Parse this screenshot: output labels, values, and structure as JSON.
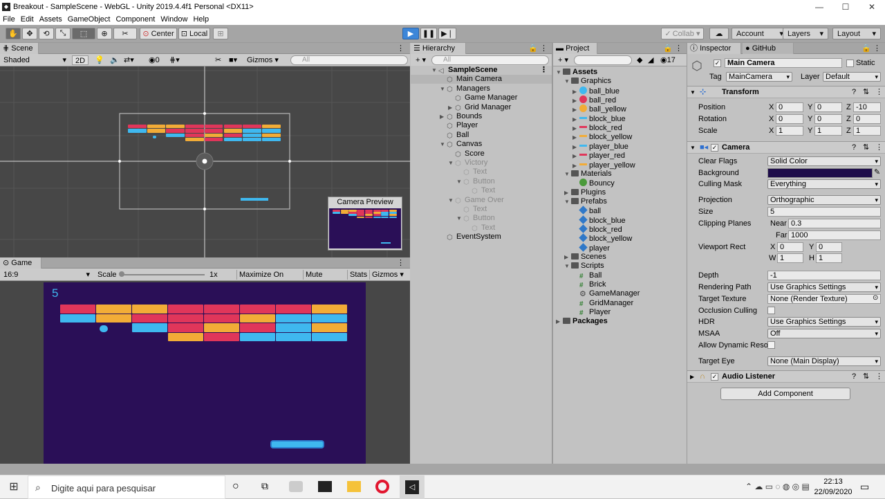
{
  "window": {
    "title": "Breakout - SampleScene - WebGL - Unity 2019.4.4f1 Personal <DX11>",
    "minimize": "—",
    "maximize": "☐",
    "close": "✕"
  },
  "menu": [
    "File",
    "Edit",
    "Assets",
    "GameObject",
    "Component",
    "Window",
    "Help"
  ],
  "toolbar": {
    "center": "Center",
    "local": "Local",
    "collab": "Collab ▾",
    "account": "Account",
    "layers": "Layers",
    "layout": "Layout"
  },
  "scene": {
    "tab": "Scene",
    "shading": "Shaded",
    "mode2d": "2D",
    "hidden_count": "0",
    "gizmos": "Gizmos",
    "search_placeholder": "All",
    "camera_preview": "Camera Preview"
  },
  "game": {
    "tab": "Game",
    "aspect": "16:9",
    "scale_label": "Scale",
    "scale_value": "1x",
    "maximize": "Maximize On Play",
    "mute": "Mute Audio",
    "stats": "Stats",
    "gizmos": "Gizmos",
    "score": "5"
  },
  "hierarchy": {
    "tab": "Hierarchy",
    "search_placeholder": "All",
    "items": [
      {
        "label": "SampleScene",
        "depth": 0,
        "arrow": "▼",
        "bold": true
      },
      {
        "label": "Main Camera",
        "depth": 1,
        "arrow": "",
        "selected": true
      },
      {
        "label": "Managers",
        "depth": 1,
        "arrow": "▼"
      },
      {
        "label": "Game Manager",
        "depth": 2,
        "arrow": ""
      },
      {
        "label": "Grid Manager",
        "depth": 2,
        "arrow": "▶"
      },
      {
        "label": "Bounds",
        "depth": 1,
        "arrow": "▶"
      },
      {
        "label": "Player",
        "depth": 1,
        "arrow": ""
      },
      {
        "label": "Ball",
        "depth": 1,
        "arrow": ""
      },
      {
        "label": "Canvas",
        "depth": 1,
        "arrow": "▼"
      },
      {
        "label": "Score",
        "depth": 2,
        "arrow": ""
      },
      {
        "label": "Victory",
        "depth": 2,
        "arrow": "▼",
        "inactive": true
      },
      {
        "label": "Text",
        "depth": 3,
        "arrow": "",
        "inactive": true
      },
      {
        "label": "Button",
        "depth": 3,
        "arrow": "▼",
        "inactive": true
      },
      {
        "label": "Text",
        "depth": 4,
        "arrow": "",
        "inactive": true
      },
      {
        "label": "Game Over",
        "depth": 2,
        "arrow": "▼",
        "inactive": true
      },
      {
        "label": "Text",
        "depth": 3,
        "arrow": "",
        "inactive": true
      },
      {
        "label": "Button",
        "depth": 3,
        "arrow": "▼",
        "inactive": true
      },
      {
        "label": "Text",
        "depth": 4,
        "arrow": "",
        "inactive": true
      },
      {
        "label": "EventSystem",
        "depth": 1,
        "arrow": ""
      }
    ]
  },
  "project": {
    "tab": "Project",
    "count": "17",
    "items": [
      {
        "label": "Assets",
        "depth": 0,
        "arrow": "▼",
        "kind": "folder",
        "bold": true
      },
      {
        "label": "Graphics",
        "depth": 1,
        "arrow": "▼",
        "kind": "folder"
      },
      {
        "label": "ball_blue",
        "depth": 2,
        "arrow": "▶",
        "kind": "ball",
        "color": "#3fb8ef"
      },
      {
        "label": "ball_red",
        "depth": 2,
        "arrow": "▶",
        "kind": "ball",
        "color": "#e0365a"
      },
      {
        "label": "ball_yellow",
        "depth": 2,
        "arrow": "▶",
        "kind": "ball",
        "color": "#f2ac37"
      },
      {
        "label": "block_blue",
        "depth": 2,
        "arrow": "▶",
        "kind": "bar",
        "color": "#3fb8ef"
      },
      {
        "label": "block_red",
        "depth": 2,
        "arrow": "▶",
        "kind": "bar",
        "color": "#e0365a"
      },
      {
        "label": "block_yellow",
        "depth": 2,
        "arrow": "▶",
        "kind": "bar",
        "color": "#f2ac37"
      },
      {
        "label": "player_blue",
        "depth": 2,
        "arrow": "▶",
        "kind": "bar",
        "color": "#3fb8ef"
      },
      {
        "label": "player_red",
        "depth": 2,
        "arrow": "▶",
        "kind": "bar",
        "color": "#e0365a"
      },
      {
        "label": "player_yellow",
        "depth": 2,
        "arrow": "▶",
        "kind": "bar",
        "color": "#f2ac37"
      },
      {
        "label": "Materials",
        "depth": 1,
        "arrow": "▼",
        "kind": "folder"
      },
      {
        "label": "Bouncy",
        "depth": 2,
        "arrow": "",
        "kind": "material",
        "color": "#4a9a3a"
      },
      {
        "label": "Plugins",
        "depth": 1,
        "arrow": "▶",
        "kind": "folder"
      },
      {
        "label": "Prefabs",
        "depth": 1,
        "arrow": "▼",
        "kind": "folder"
      },
      {
        "label": "ball",
        "depth": 2,
        "arrow": "",
        "kind": "prefab",
        "color": "#2f78c8"
      },
      {
        "label": "block_blue",
        "depth": 2,
        "arrow": "",
        "kind": "prefab",
        "color": "#2f78c8"
      },
      {
        "label": "block_red",
        "depth": 2,
        "arrow": "",
        "kind": "prefab",
        "color": "#2f78c8"
      },
      {
        "label": "block_yellow",
        "depth": 2,
        "arrow": "",
        "kind": "prefab",
        "color": "#2f78c8"
      },
      {
        "label": "player",
        "depth": 2,
        "arrow": "",
        "kind": "prefab",
        "color": "#2f78c8"
      },
      {
        "label": "Scenes",
        "depth": 1,
        "arrow": "▶",
        "kind": "folder"
      },
      {
        "label": "Scripts",
        "depth": 1,
        "arrow": "▼",
        "kind": "folder"
      },
      {
        "label": "Ball",
        "depth": 2,
        "arrow": "",
        "kind": "script"
      },
      {
        "label": "Brick",
        "depth": 2,
        "arrow": "",
        "kind": "script"
      },
      {
        "label": "GameManager",
        "depth": 2,
        "arrow": "",
        "kind": "gear"
      },
      {
        "label": "GridManager",
        "depth": 2,
        "arrow": "",
        "kind": "script"
      },
      {
        "label": "Player",
        "depth": 2,
        "arrow": "",
        "kind": "script"
      },
      {
        "label": "Packages",
        "depth": 0,
        "arrow": "▶",
        "kind": "folder",
        "bold": true
      }
    ]
  },
  "inspector": {
    "tab": "Inspector",
    "tab2": "GitHub",
    "object_name": "Main Camera",
    "static_label": "Static",
    "tag_label": "Tag",
    "tag": "MainCamera",
    "layer_label": "Layer",
    "layer": "Default",
    "transform": {
      "title": "Transform",
      "rows": [
        {
          "label": "Position",
          "x": "0",
          "y": "0",
          "z": "-10"
        },
        {
          "label": "Rotation",
          "x": "0",
          "y": "0",
          "z": "0"
        },
        {
          "label": "Scale",
          "x": "1",
          "y": "1",
          "z": "1"
        }
      ]
    },
    "camera": {
      "title": "Camera",
      "clear_flags_label": "Clear Flags",
      "clear_flags": "Solid Color",
      "background_label": "Background",
      "background_color": "#1e0d4a",
      "culling_mask_label": "Culling Mask",
      "culling_mask": "Everything",
      "projection_label": "Projection",
      "projection": "Orthographic",
      "size_label": "Size",
      "size": "5",
      "clipping_label": "Clipping Planes",
      "near_label": "Near",
      "near": "0.3",
      "far_label": "Far",
      "far": "1000",
      "viewport_label": "Viewport Rect",
      "vx": "0",
      "vy": "0",
      "vw": "1",
      "vh": "1",
      "depth_label": "Depth",
      "depth": "-1",
      "rendering_path_label": "Rendering Path",
      "rendering_path": "Use Graphics Settings",
      "target_texture_label": "Target Texture",
      "target_texture": "None (Render Texture)",
      "occlusion_label": "Occlusion Culling",
      "hdr_label": "HDR",
      "hdr": "Use Graphics Settings",
      "msaa_label": "MSAA",
      "msaa": "Off",
      "dynres_label": "Allow Dynamic Reso",
      "target_eye_label": "Target Eye",
      "target_eye": "None (Main Display)"
    },
    "audio_listener": "Audio Listener",
    "add_component": "Add Component"
  },
  "taskbar": {
    "search_placeholder": "Digite aqui para pesquisar",
    "time": "22:13",
    "date": "22/09/2020"
  },
  "colors": {
    "game_bg": "#2a0f57",
    "play_blue": "#3d86d8",
    "selection": "#bcbcbc"
  }
}
